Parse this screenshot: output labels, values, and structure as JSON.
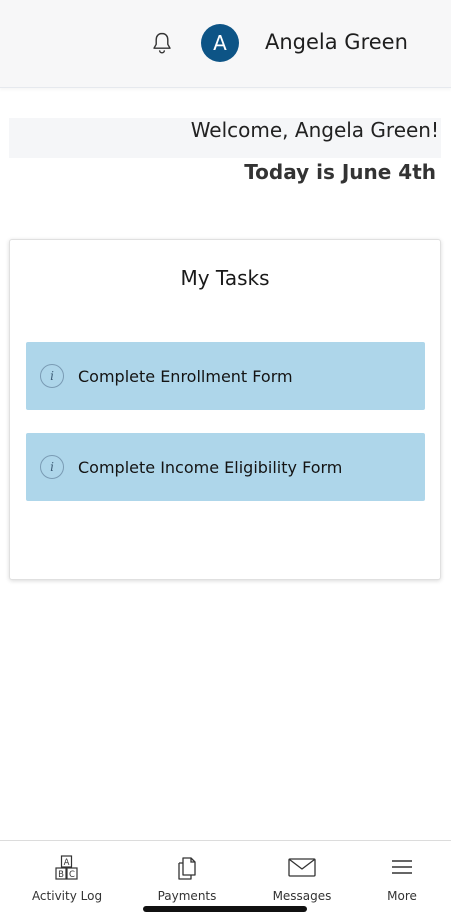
{
  "header": {
    "bell_icon": "bell-icon",
    "avatar_initial": "A",
    "avatar_color": "#0d5486",
    "user_name": "Angela Green"
  },
  "greeting": {
    "welcome": "Welcome, Angela Green!",
    "today": "Today is June 4th"
  },
  "tasks": {
    "title": "My Tasks",
    "item_color": "#aed6ea",
    "items": [
      {
        "icon": "info-icon",
        "label": "Complete Enrollment Form"
      },
      {
        "icon": "info-icon",
        "label": "Complete Income Eligibility Form"
      }
    ]
  },
  "bottom_nav": {
    "items": [
      {
        "icon": "abc-blocks-icon",
        "label": "Activity Log"
      },
      {
        "icon": "documents-icon",
        "label": "Payments"
      },
      {
        "icon": "envelope-icon",
        "label": "Messages"
      },
      {
        "icon": "hamburger-menu-icon",
        "label": "More"
      }
    ]
  }
}
